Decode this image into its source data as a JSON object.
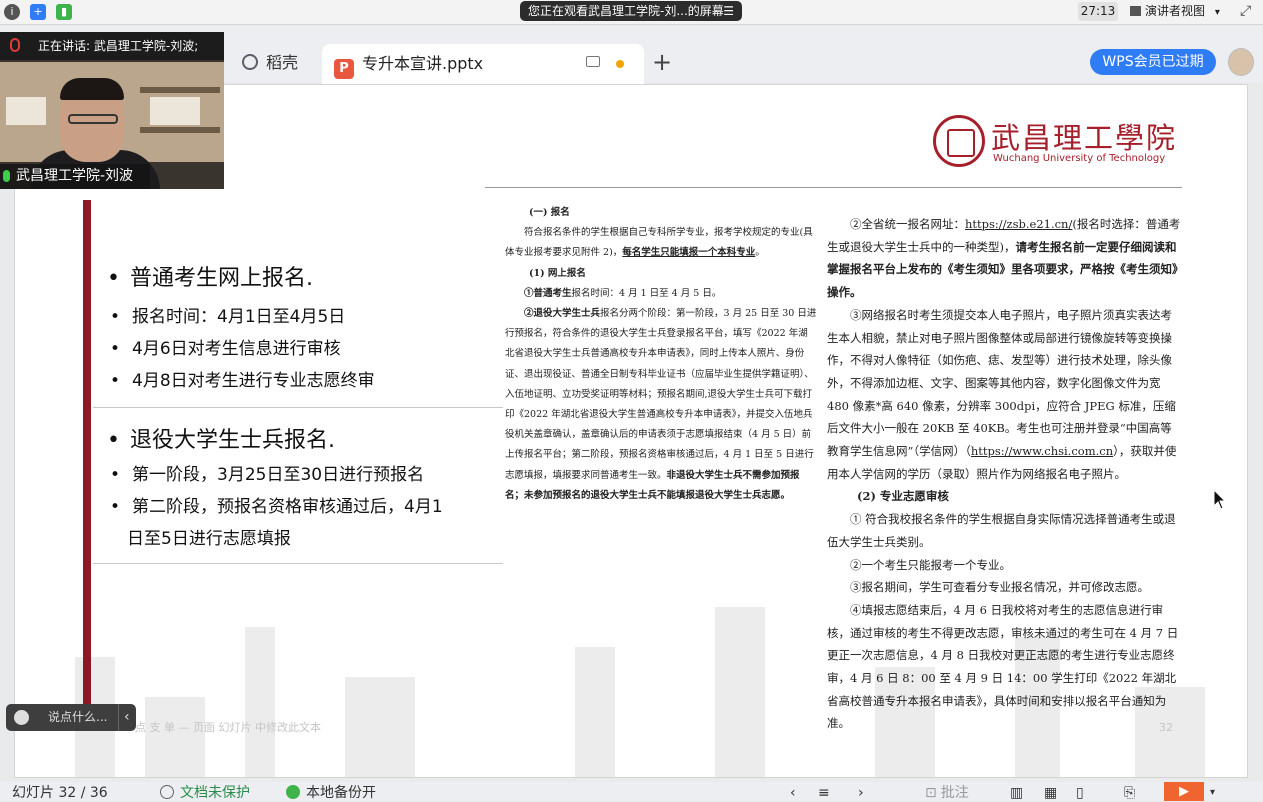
{
  "meeting": {
    "sharing_text": "您正在观看武昌理工学院-刘...的屏幕",
    "menu_glyph": "☰",
    "timer": "27:13",
    "presenter_view": "演讲者视图",
    "dropdown_glyph": "▾",
    "speaking_label": "正在讲话: 武昌理工学院-刘波;",
    "camera_name": "武昌理工学院-刘波",
    "chat_placeholder": "说点什么...",
    "chat_collapse_glyph": "‹"
  },
  "tabs": {
    "docer": "稻壳",
    "file": "专升本宣讲.pptx",
    "file_icon_letter": "P",
    "new_tab_glyph": "+",
    "wps_member": "WPS会员已过期"
  },
  "slide": {
    "logo_cn": "武昌理工學院",
    "logo_en": "Wuchang University of Technology",
    "group1": {
      "title": "普通考生网上报名.",
      "items": [
        "报名时间：4月1日至4月5日",
        "4月6日对考生信息进行审核",
        "4月8日对考生进行专业志愿终审"
      ]
    },
    "group2": {
      "title": "退役大学生士兵报名.",
      "items": [
        "第一阶段，3月25日至30日进行预报名",
        "第二阶段，预报名资格审核通过后，4月1",
        "日至5日进行志愿填报"
      ]
    },
    "doc_mid": {
      "heading": "(一) 报名",
      "p1a": "符合报名条件的学生根据自己专科所学专业，报考学校规定的专业(具体专业报考要求见附件 2)，",
      "p1b": "每名学生只能填报一个本科专业",
      "p1c": "。",
      "sub1": "(1) 网上报名",
      "p2a": "①普通考生",
      "p2b": "报名时间：4 月 1 日至 4 月 5 日。",
      "p3a": "②退役大学生士兵",
      "p3b": "报名分两个阶段：第一阶段，3 月 25 日至 30 日进行预报名，符合条件的退役大学生士兵登录报名平台，填写《2022 年湖北省退役大学生士兵普通高校专升本申请表》，同时上传本人照片、身份证、退出现役证、普通全日制专科毕业证书（应届毕业生提供学籍证明）、入伍地证明、立功受奖证明等材料；预报名期间,退役大学生士兵可下载打印《2022 年湖北省退役大学生普通高校专升本申请表》，并提交入伍地兵役机关盖章确认，盖章确认后的申请表须于志愿填报结束（4 月 5 日）前上传报名平台；第二阶段，预报名资格审核通过后，4 月 1 日至 5 日进行志愿填报，填报要求同普通考生一致。",
      "p3c": "非退役大学生士兵不需参加预报名；未参加预报名的退役大学生士兵不能填报退役大学生士兵志愿。"
    },
    "doc_right": {
      "p1a": "②全省统一报名网址：",
      "url1": "https://zsb.e21.cn/",
      "p1b": "(报名时选择：普通考生或退役大学生士兵中的一种类型)，",
      "p1c": "请考生报名前一定要仔细阅读和掌握报名平台上发布的《考生须知》里各项要求，严格按《考生须知》操作。",
      "p2": "③网络报名时考生须提交本人电子照片，电子照片须真实表达考生本人相貌，禁止对电子照片图像整体或局部进行镜像旋转等变换操作，不得对人像特征（如伤疤、痣、发型等）进行技术处理，除头像外，不得添加边框、文字、图案等其他内容，数字化图像文件为宽 480 像素*高 640 像素，分辨率 300dpi，应符合 JPEG 标准，压缩后文件大小一般在 20KB 至 40KB。考生也可注册并登录“中国高等教育学生信息网”（学信网）（",
      "url2": "https://www.chsi.com.cn",
      "p2b": "），获取并使用本人学信网的学历（录取）照片作为网络报名电子照片。",
      "sub2": "(2) 专业志愿审核",
      "l1": "① 符合我校报名条件的学生根据自身实际情况选择普通考生或退伍大学生士兵类别。",
      "l2": "②一个考生只能报考一个专业。",
      "l3": "③报名期间，学生可查看分专业报名情况，并可修改志愿。",
      "l4": "④填报志愿结束后，4 月 6 日我校将对考生的志愿信息进行审核，通过审核的考生不得更改志愿，审核未通过的考生可在 4 月 7 日更正一次志愿信息，4 月 8 日我校对更正志愿的考生进行专业志愿终审，4 月 6 日 8：00 至 4 月 9 日 14：00 学生打印《2022 年湖北省高校普通专升本报名申请表》，具体时间和安排以报名平台通知为准。"
    },
    "footer": "点 支 单 — 页面 幻灯片 中修改此文本",
    "page_number": "32"
  },
  "statusbar": {
    "slide_counter": "幻灯片 32 / 36",
    "protection": "文档未保护",
    "backup": "本地备份开",
    "annotate": "批注"
  },
  "colors": {
    "brand_red": "#a5202b",
    "accent_blue": "#2f7df6",
    "play_orange": "#f0652f"
  }
}
